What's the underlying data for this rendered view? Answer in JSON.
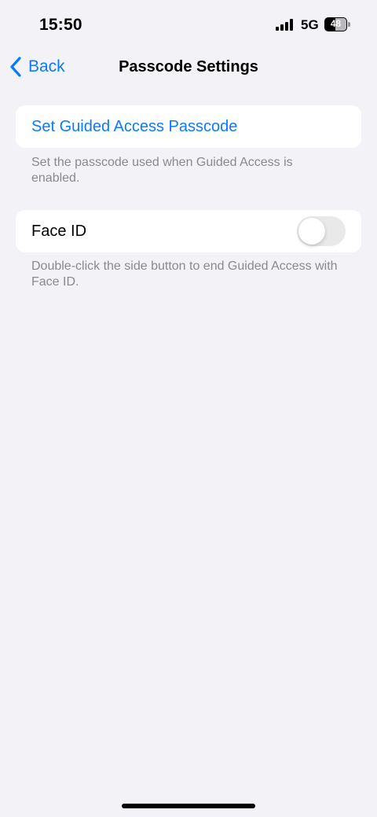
{
  "status_bar": {
    "time": "15:50",
    "network": "5G",
    "battery_level": "48",
    "battery_fraction": 0.48,
    "signal_bars": 4
  },
  "nav": {
    "back_label": "Back",
    "title": "Passcode Settings"
  },
  "sections": {
    "passcode": {
      "link_label": "Set Guided Access Passcode",
      "footer": "Set the passcode used when Guided Access is enabled."
    },
    "face_id": {
      "label": "Face ID",
      "toggle_on": false,
      "footer": "Double-click the side button to end Guided Access with Face ID."
    }
  },
  "colors": {
    "accent": "#0a7aff",
    "background": "#f2f2f7",
    "footer_text": "#8a8a8e",
    "toggle_off": "#e9e9ea"
  },
  "icons": {
    "back": "chevron-left-icon",
    "signal": "cellular-signal-icon",
    "battery": "battery-icon"
  }
}
